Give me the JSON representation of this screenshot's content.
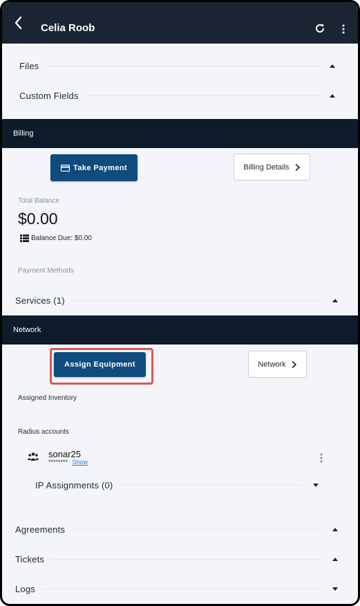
{
  "header": {
    "title": "Celia Roob",
    "back_icon": "chevron-left-icon",
    "refresh_icon": "refresh-icon",
    "more_icon": "more-vertical-icon",
    "background": "#1b2433"
  },
  "sections_top": {
    "files": "Files",
    "custom_fields": "Custom Fields"
  },
  "billing": {
    "band_label": "Billing",
    "take_payment": "Take Payment",
    "billing_details": "Billing Details",
    "total_balance_label": "Total Balance",
    "total_balance_value": "$0.00",
    "balance_due": "Balance Due: $0.00",
    "payment_methods": "Payment Methods",
    "services": "Services (1)"
  },
  "network": {
    "band_label": "Network",
    "assign_equipment": "Assign Equipment",
    "network_button": "Network",
    "assigned_inventory": "Assigned Inventory",
    "radius_accounts": "Radius accounts",
    "radius_user": "sonar25",
    "radius_password_mask": "********",
    "show_link": "Show",
    "ip_assignments": "IP Assignments (0)"
  },
  "sections_bottom": {
    "agreements": "Agreements",
    "tickets": "Tickets",
    "logs": "Logs"
  },
  "colors": {
    "primary_button": "#104b7e",
    "band": "#0d1b2a",
    "highlight": "#e05656",
    "link": "#2b7bd8"
  }
}
